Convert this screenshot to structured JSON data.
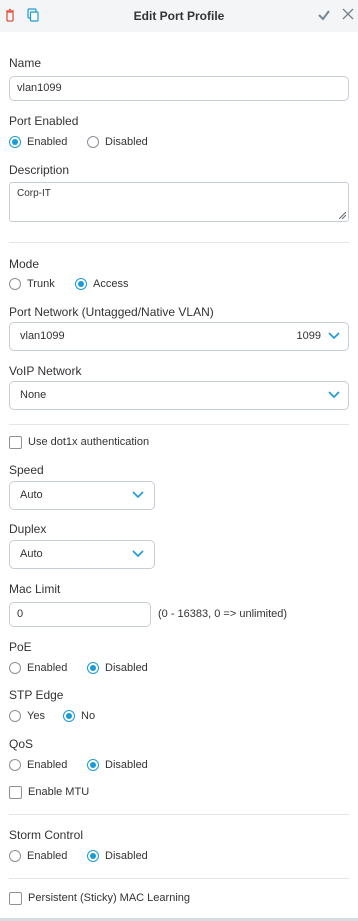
{
  "header": {
    "title": "Edit Port Profile",
    "icons": [
      "trash-icon",
      "copy-icon",
      "check-icon",
      "close-icon"
    ],
    "accent_color": "#1a9bd7",
    "trash_color": "#e0533f"
  },
  "name": {
    "label": "Name",
    "value": "vlan1099"
  },
  "port_enabled": {
    "label": "Port Enabled",
    "options": [
      "Enabled",
      "Disabled"
    ],
    "selected": "Enabled"
  },
  "description": {
    "label": "Description",
    "value": "Corp-IT"
  },
  "mode": {
    "label": "Mode",
    "options": [
      "Trunk",
      "Access"
    ],
    "selected": "Access"
  },
  "port_network": {
    "label": "Port Network (Untagged/Native VLAN)",
    "value": "vlan1099",
    "vlan_id": "1099"
  },
  "voip_network": {
    "label": "VoIP Network",
    "value": "None"
  },
  "dot1x": {
    "label": "Use dot1x authentication",
    "checked": false
  },
  "speed": {
    "label": "Speed",
    "value": "Auto"
  },
  "duplex": {
    "label": "Duplex",
    "value": "Auto"
  },
  "mac_limit": {
    "label": "Mac Limit",
    "value": "0",
    "hint": "(0 - 16383, 0 => unlimited)"
  },
  "poe": {
    "label": "PoE",
    "options": [
      "Enabled",
      "Disabled"
    ],
    "selected": "Disabled"
  },
  "stp_edge": {
    "label": "STP Edge",
    "options": [
      "Yes",
      "No"
    ],
    "selected": "No"
  },
  "qos": {
    "label": "QoS",
    "options": [
      "Enabled",
      "Disabled"
    ],
    "selected": "Disabled"
  },
  "enable_mtu": {
    "label": "Enable MTU",
    "checked": false
  },
  "storm_control": {
    "label": "Storm Control",
    "options": [
      "Enabled",
      "Disabled"
    ],
    "selected": "Disabled"
  },
  "persistent_mac": {
    "label": "Persistent (Sticky) MAC Learning",
    "checked": false
  }
}
